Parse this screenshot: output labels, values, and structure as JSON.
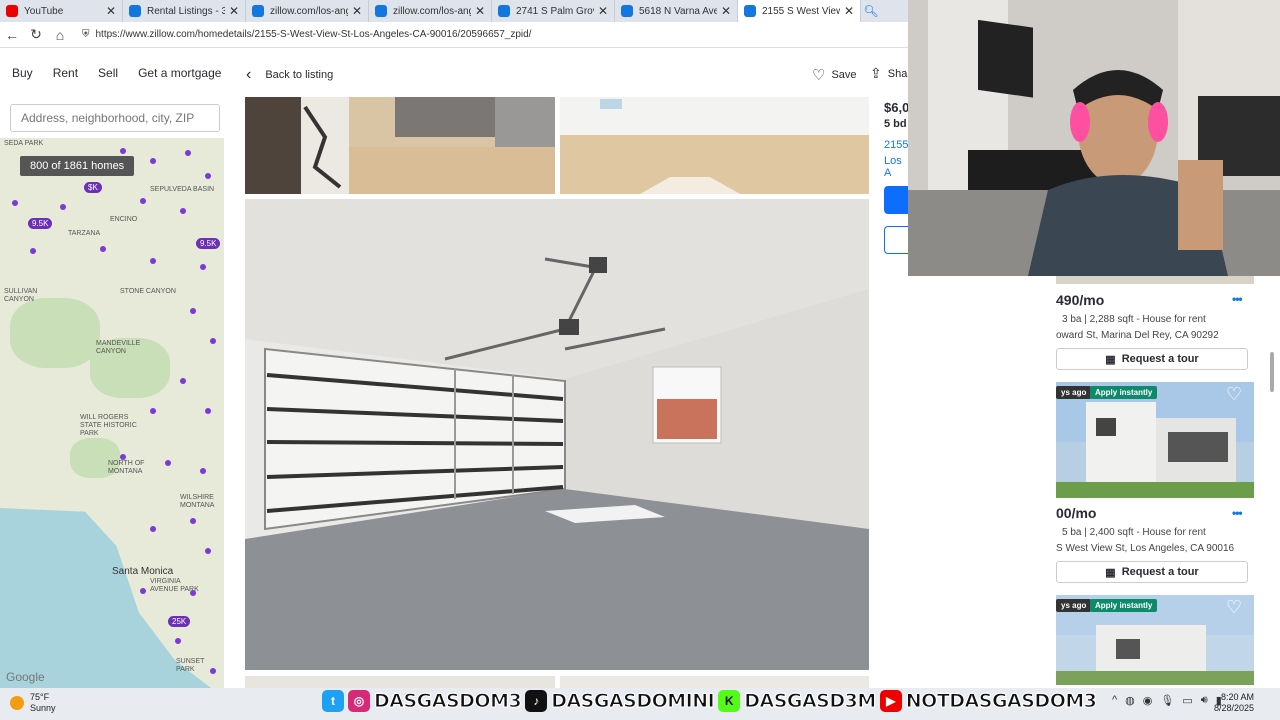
{
  "browser": {
    "tabs": [
      {
        "title": "YouTube",
        "icon": "youtube-icon",
        "active": false
      },
      {
        "title": "Rental Listings - 3472 P",
        "icon": "zillow-icon",
        "active": false
      },
      {
        "title": "zillow.com/los-angeles",
        "icon": "zillow-icon",
        "active": false
      },
      {
        "title": "zillow.com/los-angeles",
        "icon": "zillow-icon",
        "active": false
      },
      {
        "title": "2741 S Palm Grove Ave",
        "icon": "zillow-icon",
        "active": false
      },
      {
        "title": "5618 N Varna Ave, Van",
        "icon": "zillow-icon",
        "active": false
      },
      {
        "title": "2155 S West View St, Lo",
        "icon": "zillow-icon",
        "active": true
      }
    ],
    "url": "https://www.zillow.com/homedetails/2155-S-West-View-St-Los-Angeles-CA-90016/20596657_zpid/"
  },
  "zillow": {
    "nav": [
      "Buy",
      "Rent",
      "Sell",
      "Get a mortgage"
    ],
    "search_placeholder": "Address, neighborhood, city, ZIP",
    "homes_count": "800 of 1861 homes",
    "map_cities": [
      "Santa Monica"
    ],
    "map_labels": [
      "SEDA PARK",
      "SEPULVEDA BASIN",
      "ENCINO",
      "TARZANA",
      "Sullivan Canyon",
      "Stone Canyon",
      "MANDEVILLE CANYON",
      "Will Rogers State Historic Park",
      "NORTH OF MONTANA",
      "Wilshire Montana",
      "Virginia Avenue Park",
      "Sunset Park"
    ],
    "map_pills": [
      "$K",
      "9.5K",
      "9.5K",
      "25K"
    ],
    "google_logo": "Google",
    "back_label": "Back to listing",
    "save_label": "Save",
    "share_label": "Sha",
    "price": "$6,0",
    "beds": "5 bd",
    "address_line1": "2155",
    "address_line2": "Los A"
  },
  "listings": [
    {
      "price": "490/mo",
      "meta": "3 ba | 2,288 sqft - House for rent",
      "address": "oward St, Marina Del Rey, CA 90292",
      "tour": "Request a tour"
    },
    {
      "price": "00/mo",
      "meta": "5 ba | 2,400 sqft - House for rent",
      "address": "S West View St, Los Angeles, CA 90016",
      "tour": "Request a tour",
      "badge_time": "ys ago",
      "badge": "Apply instantly"
    },
    {
      "badge_time": "ys ago",
      "badge": "Apply instantly"
    }
  ],
  "taskbar": {
    "temp": "75°F",
    "weather": "Sunny",
    "socials": [
      "DASGASDOM3",
      "DASGASDOMINI",
      "DASGASD3M",
      "NOTDASGASDOM3"
    ],
    "time": "8:20 AM",
    "date": "8/28/2025"
  }
}
